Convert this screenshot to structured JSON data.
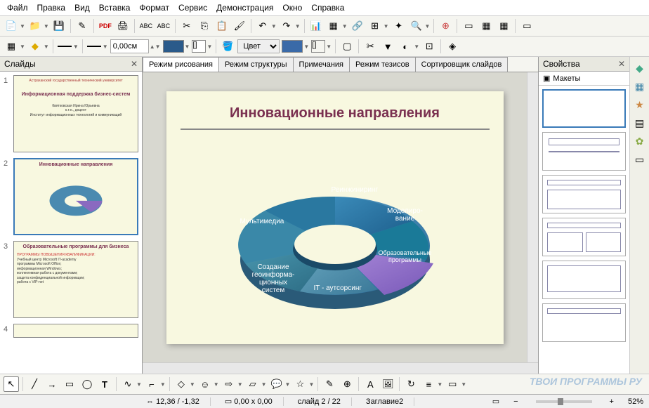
{
  "menu": {
    "items": [
      "Файл",
      "Правка",
      "Вид",
      "Вставка",
      "Формат",
      "Сервис",
      "Демонстрация",
      "Окно",
      "Справка"
    ]
  },
  "toolbar2": {
    "width_value": "0,00см",
    "color_label": "Цвет"
  },
  "slides_panel": {
    "title": "Слайды"
  },
  "thumbs": {
    "s1": {
      "org": "Астраханский государственный технический университет",
      "title": "Информационная поддержка бизнес-систем",
      "author": "Квятковская Ирина Юрьевна",
      "deg": "к.т.н., доцент",
      "inst": "Институт информационных технологий и коммуникаций"
    },
    "s2": {
      "title": "Инновационные направления"
    },
    "s3": {
      "title": "Образовательные программы для бизнеса",
      "sub": "ПРОГРАММЫ ПОВЫШЕНИЯ КВАЛИФИКАЦИИ:",
      "l1": "Учебный центр Microsoft IT-academy",
      "l2": "программы Microsoft Office;",
      "l3": "информационная Windows;",
      "l4": "коллективная работа с документами;",
      "l5": "защита конфиденциальной информации;",
      "l6": "работа с VIP-net"
    }
  },
  "view_tabs": {
    "t1": "Режим рисования",
    "t2": "Режим структуры",
    "t3": "Примечания",
    "t4": "Режим тезисов",
    "t5": "Сортировщик слайдов"
  },
  "slide": {
    "title": "Инновационные направления",
    "seg1": "Реинжиниринг",
    "seg2": "Моделиро-\nвание",
    "seg3": "Образовательные программы",
    "seg4": "IT - аутсорсинг",
    "seg5": "Создание геоинформа-ционных систем",
    "seg6": "Мультимедиа"
  },
  "props": {
    "title": "Свойства",
    "section": "Макеты"
  },
  "status": {
    "pos": "12,36 / -1,32",
    "size": "0,00 x 0,00",
    "page": "слайд 2 / 22",
    "master": "Заглавие2",
    "zoom": "52%"
  },
  "watermark": "ТВОИ ПРОГРАММЫ РУ"
}
